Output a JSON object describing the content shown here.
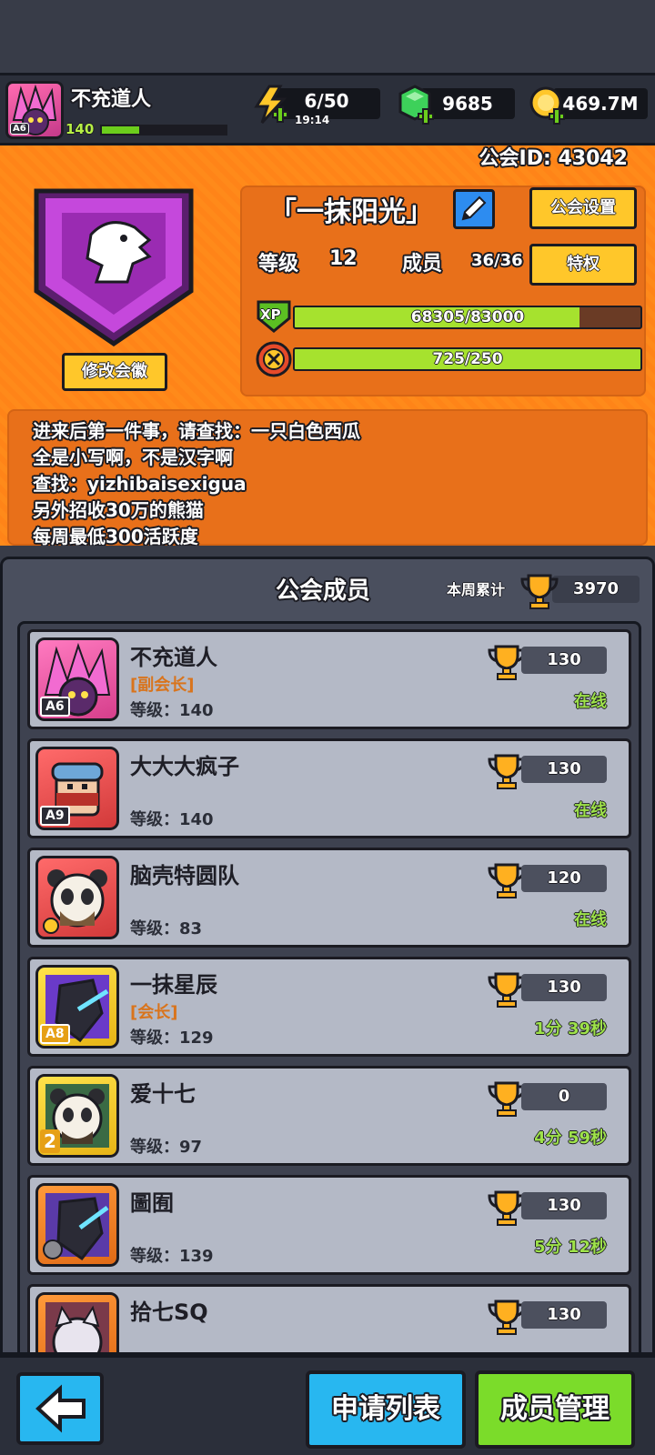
{
  "header": {
    "player_name": "不充道人",
    "player_level": "140",
    "player_rank": "A6",
    "energy": "6/50",
    "energy_timer": "19:14",
    "gems": "9685",
    "gold": "469.7M"
  },
  "guild": {
    "id_label": "公会ID: 43042",
    "name": "「一抹阳光」",
    "settings_button": "公会设置",
    "level_label": "等级",
    "level_value": "12",
    "members_label": "成员",
    "members_value": "36/36",
    "privilege_button": "特权",
    "xp_icon_text": "XP",
    "xp_text": "68305/83000",
    "xp_progress": 0.823,
    "contribution_text": "725/250",
    "contribution_progress": 1.0,
    "change_badge_button": "修改会徽"
  },
  "notice": {
    "lines": [
      "进来后第一件事，请查找：一只白色西瓜",
      "全是小写啊，不是汉字啊",
      "查找：yizhibaisexigua",
      "另外招收30万的熊猫",
      "每周最低300活跃度"
    ]
  },
  "members_panel": {
    "title": "公会成员",
    "weekly_label": "本周累计",
    "weekly_value": "3970",
    "members": [
      {
        "name": "不充道人",
        "role": "[副会长]",
        "level": "等级：140",
        "score": "130",
        "status": "在线",
        "rank": "A6"
      },
      {
        "name": "大大大疯子",
        "role": "",
        "level": "等级：140",
        "score": "130",
        "status": "在线",
        "rank": "A9"
      },
      {
        "name": "脑壳特圆队",
        "role": "",
        "level": "等级：83",
        "score": "120",
        "status": "在线",
        "rank": ""
      },
      {
        "name": "一抹星辰",
        "role": "[会长]",
        "level": "等级：129",
        "score": "130",
        "status": "1分 39秒",
        "rank": "A8"
      },
      {
        "name": "爱十七",
        "role": "",
        "level": "等级：97",
        "score": "0",
        "status": "4分 59秒",
        "rank": "2"
      },
      {
        "name": "圖囿",
        "role": "",
        "level": "等级：139",
        "score": "130",
        "status": "5分 12秒",
        "rank": ""
      },
      {
        "name": "拾七SQ",
        "role": "",
        "level": "",
        "score": "130",
        "status": "",
        "rank": ""
      }
    ]
  },
  "bottom": {
    "apply_list_button": "申请列表",
    "member_manage_button": "成员管理"
  },
  "colors": {
    "orange": "#ff8a1a",
    "badge_purple": "#b23cc8",
    "online_green": "#9ee24a",
    "xp_green": "#a6e22e",
    "button_yellow": "#ffc72a",
    "button_blue": "#28b7f0",
    "button_green": "#7bdc2a"
  }
}
